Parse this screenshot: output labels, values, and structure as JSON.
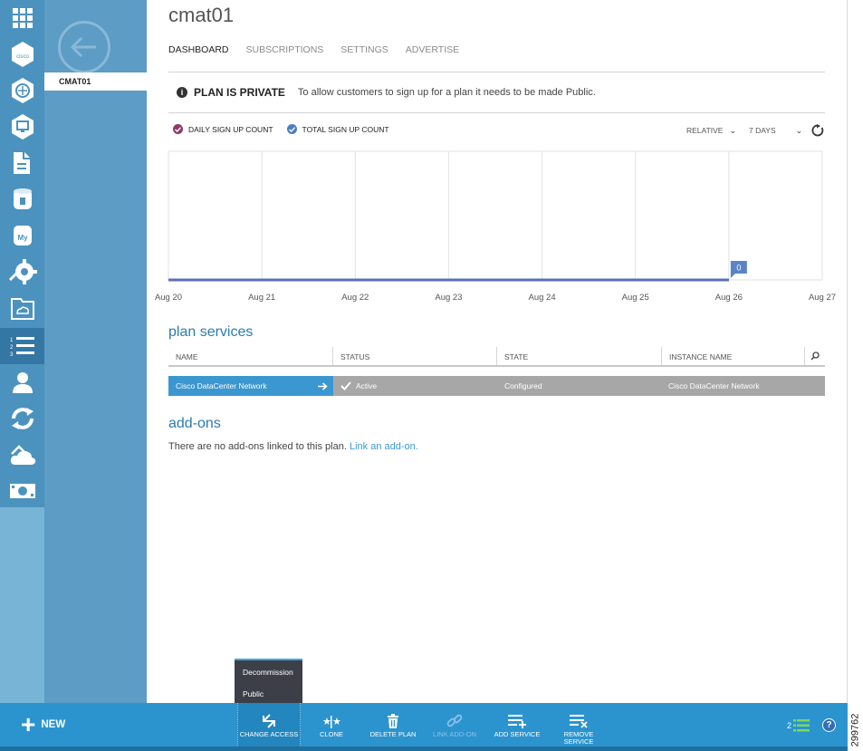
{
  "page": {
    "title": "cmat01"
  },
  "nav": {
    "selected_item": "CMAT01"
  },
  "tabs": [
    {
      "label": "DASHBOARD",
      "active": true
    },
    {
      "label": "SUBSCRIPTIONS",
      "active": false
    },
    {
      "label": "SETTINGS",
      "active": false
    },
    {
      "label": "ADVERTISE",
      "active": false
    }
  ],
  "notice": {
    "title": "PLAN IS PRIVATE",
    "text": "To allow customers to sign up for a plan it needs to be made Public."
  },
  "chart_controls": {
    "legend": [
      {
        "label": "DAILY SIGN UP COUNT",
        "color": "#8e3a6b"
      },
      {
        "label": "TOTAL SIGN UP COUNT",
        "color": "#4a7fc4"
      }
    ],
    "mode": "RELATIVE",
    "period": "7 DAYS"
  },
  "chart_data": {
    "type": "line",
    "categories": [
      "Aug 20",
      "Aug 21",
      "Aug 22",
      "Aug 23",
      "Aug 24",
      "Aug 25",
      "Aug 26",
      "Aug 27"
    ],
    "series": [
      {
        "name": "DAILY SIGN UP COUNT",
        "values": [
          0,
          0,
          0,
          0,
          0,
          0,
          0
        ]
      },
      {
        "name": "TOTAL SIGN UP COUNT",
        "values": [
          0,
          0,
          0,
          0,
          0,
          0,
          0
        ]
      }
    ],
    "annotations": [
      {
        "category": "Aug 26",
        "label": "0"
      }
    ],
    "grid": true,
    "colors": {
      "line": "#5b6fb5",
      "grid": "#e2e2e2",
      "label_box": "#5b84c6"
    }
  },
  "plan_services": {
    "title": "plan services",
    "columns": [
      "NAME",
      "STATUS",
      "STATE",
      "INSTANCE NAME"
    ],
    "rows": [
      {
        "name": "Cisco DataCenter Network",
        "status": "Active",
        "state": "Configured",
        "instance_name": "Cisco DataCenter Network"
      }
    ]
  },
  "addons": {
    "title": "add-ons",
    "text": "There are no add-ons linked to this plan.",
    "link": "Link an add-on."
  },
  "popup_menu": {
    "items": [
      "Decommission",
      "Public"
    ]
  },
  "command_bar": {
    "new_label": "NEW",
    "commands": [
      {
        "id": "change_access",
        "label": "CHANGE ACCESS",
        "icon": "change-access-icon",
        "enabled": true
      },
      {
        "id": "clone",
        "label": "CLONE",
        "icon": "clone-icon",
        "enabled": true
      },
      {
        "id": "delete_plan",
        "label": "DELETE PLAN",
        "icon": "trash-icon",
        "enabled": true
      },
      {
        "id": "link_addon",
        "label": "LINK ADD-ON",
        "icon": "link-icon",
        "enabled": false
      },
      {
        "id": "add_service",
        "label": "ADD SERVICE",
        "icon": "add-service-icon",
        "enabled": true
      },
      {
        "id": "remove_service",
        "label": "REMOVE SERVICE",
        "icon": "remove-service-icon",
        "enabled": true
      }
    ],
    "notification_count": "2"
  },
  "figure_id": "299762"
}
